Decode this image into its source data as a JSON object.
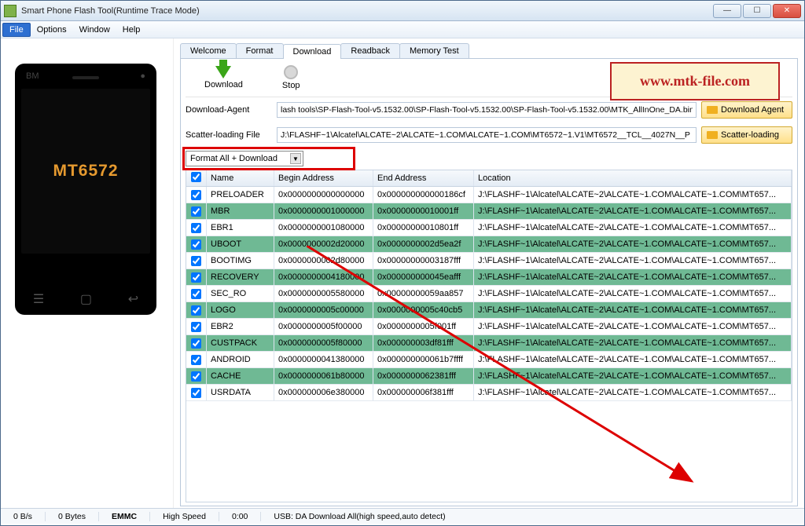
{
  "window": {
    "title": "Smart Phone Flash Tool(Runtime Trace Mode)"
  },
  "menu": {
    "file": "File",
    "options": "Options",
    "window": "Window",
    "help": "Help"
  },
  "phone": {
    "label": "MT6572",
    "brand": "BM"
  },
  "tabs": {
    "welcome": "Welcome",
    "format": "Format",
    "download": "Download",
    "readback": "Readback",
    "memtest": "Memory Test"
  },
  "toolbar": {
    "download": "Download",
    "stop": "Stop"
  },
  "watermark": "www.mtk-file.com",
  "fields": {
    "da_label": "Download-Agent",
    "da_value": "lash tools\\SP-Flash-Tool-v5.1532.00\\SP-Flash-Tool-v5.1532.00\\SP-Flash-Tool-v5.1532.00\\MTK_AllInOne_DA.bin",
    "da_button": "Download Agent",
    "scatter_label": "Scatter-loading File",
    "scatter_value": "J:\\FLASHF~1\\Alcatel\\ALCATE~2\\ALCATE~1.COM\\ALCATE~1.COM\\MT6572~1.V1\\MT6572__TCL__4027N__P",
    "scatter_button": "Scatter-loading",
    "combo": "Format All + Download"
  },
  "gridhead": {
    "name": "Name",
    "begin": "Begin Address",
    "end": "End Address",
    "loc": "Location"
  },
  "rows": [
    {
      "green": false,
      "name": "PRELOADER",
      "begin": "0x0000000000000000",
      "end": "0x000000000000186cf",
      "loc": "J:\\FLASHF~1\\Alcatel\\ALCATE~2\\ALCATE~1.COM\\ALCATE~1.COM\\MT657..."
    },
    {
      "green": true,
      "name": "MBR",
      "begin": "0x0000000001000000",
      "end": "0x00000000010001ff",
      "loc": "J:\\FLASHF~1\\Alcatel\\ALCATE~2\\ALCATE~1.COM\\ALCATE~1.COM\\MT657..."
    },
    {
      "green": false,
      "name": "EBR1",
      "begin": "0x0000000001080000",
      "end": "0x00000000010801ff",
      "loc": "J:\\FLASHF~1\\Alcatel\\ALCATE~2\\ALCATE~1.COM\\ALCATE~1.COM\\MT657..."
    },
    {
      "green": true,
      "name": "UBOOT",
      "begin": "0x0000000002d20000",
      "end": "0x0000000002d5ea2f",
      "loc": "J:\\FLASHF~1\\Alcatel\\ALCATE~2\\ALCATE~1.COM\\ALCATE~1.COM\\MT657..."
    },
    {
      "green": false,
      "name": "BOOTIMG",
      "begin": "0x0000000002d80000",
      "end": "0x00000000003187fff",
      "loc": "J:\\FLASHF~1\\Alcatel\\ALCATE~2\\ALCATE~1.COM\\ALCATE~1.COM\\MT657..."
    },
    {
      "green": true,
      "name": "RECOVERY",
      "begin": "0x0000000004180000",
      "end": "0x000000000045eafff",
      "loc": "J:\\FLASHF~1\\Alcatel\\ALCATE~2\\ALCATE~1.COM\\ALCATE~1.COM\\MT657..."
    },
    {
      "green": false,
      "name": "SEC_RO",
      "begin": "0x0000000005580000",
      "end": "0x00000000059aa857",
      "loc": "J:\\FLASHF~1\\Alcatel\\ALCATE~2\\ALCATE~1.COM\\ALCATE~1.COM\\MT657..."
    },
    {
      "green": true,
      "name": "LOGO",
      "begin": "0x0000000005c00000",
      "end": "0x0000000005c40cb5",
      "loc": "J:\\FLASHF~1\\Alcatel\\ALCATE~2\\ALCATE~1.COM\\ALCATE~1.COM\\MT657..."
    },
    {
      "green": false,
      "name": "EBR2",
      "begin": "0x0000000005f00000",
      "end": "0x0000000005f001ff",
      "loc": "J:\\FLASHF~1\\Alcatel\\ALCATE~2\\ALCATE~1.COM\\ALCATE~1.COM\\MT657..."
    },
    {
      "green": true,
      "name": "CUSTPACK",
      "begin": "0x0000000005f80000",
      "end": "0x000000003df81fff",
      "loc": "J:\\FLASHF~1\\Alcatel\\ALCATE~2\\ALCATE~1.COM\\ALCATE~1.COM\\MT657..."
    },
    {
      "green": false,
      "name": "ANDROID",
      "begin": "0x0000000041380000",
      "end": "0x000000000061b7ffff",
      "loc": "J:\\FLASHF~1\\Alcatel\\ALCATE~2\\ALCATE~1.COM\\ALCATE~1.COM\\MT657..."
    },
    {
      "green": true,
      "name": "CACHE",
      "begin": "0x0000000061b80000",
      "end": "0x0000000062381fff",
      "loc": "J:\\FLASHF~1\\Alcatel\\ALCATE~2\\ALCATE~1.COM\\ALCATE~1.COM\\MT657..."
    },
    {
      "green": false,
      "name": "USRDATA",
      "begin": "0x000000006e380000",
      "end": "0x000000006f381fff",
      "loc": "J:\\FLASHF~1\\Alcatel\\ALCATE~2\\ALCATE~1.COM\\ALCATE~1.COM\\MT657..."
    }
  ],
  "status": {
    "speed": "0 B/s",
    "bytes": "0 Bytes",
    "storage": "EMMC",
    "mode": "High Speed",
    "time": "0:00",
    "usb": "USB: DA Download All(high speed,auto detect)"
  }
}
